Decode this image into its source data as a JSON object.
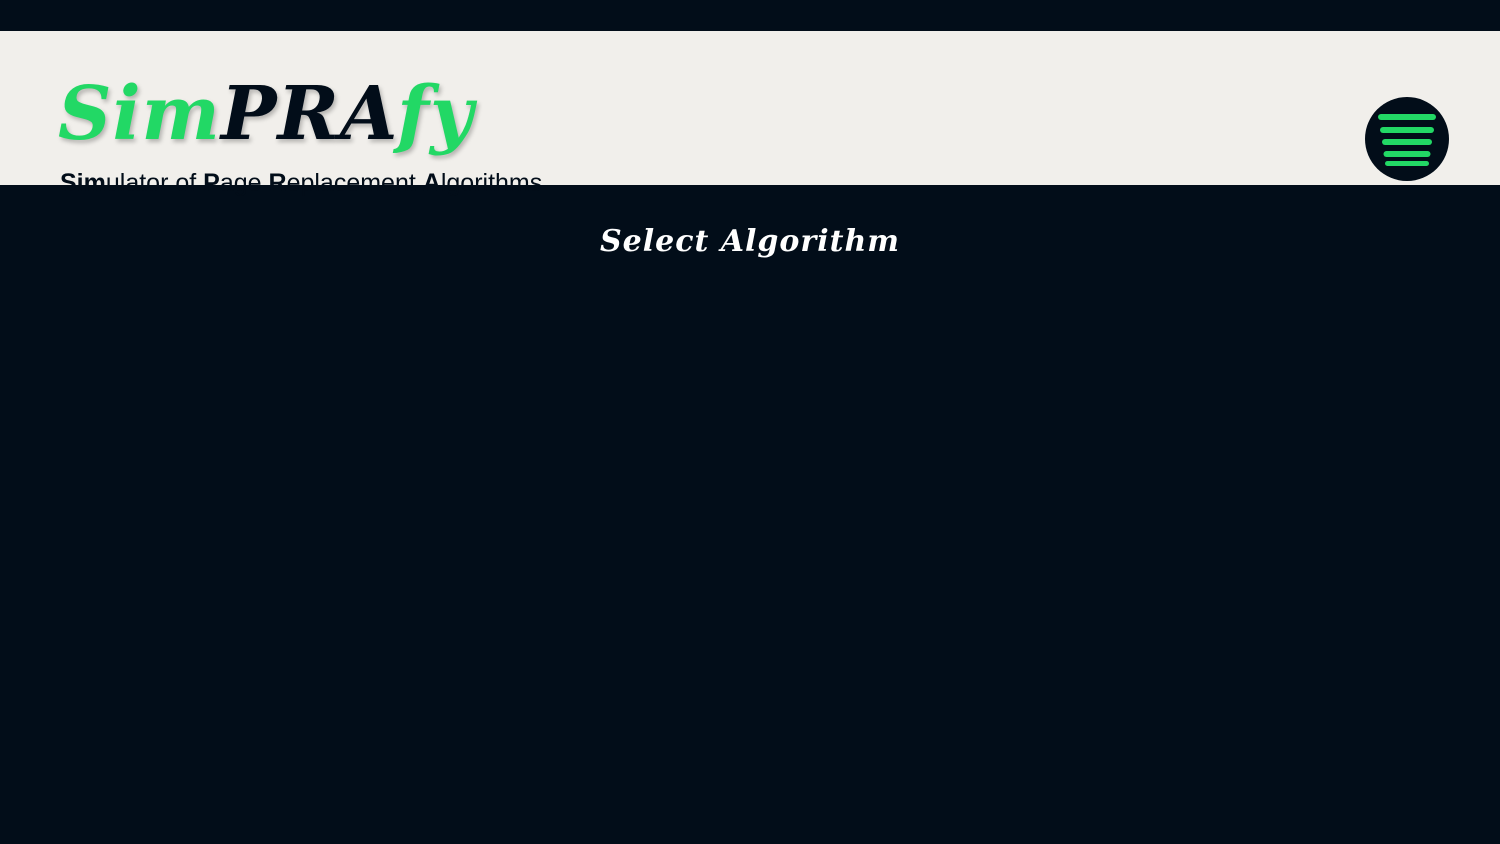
{
  "logo": {
    "part1": "Sim",
    "part2": "PRA",
    "part3": "fy"
  },
  "subtitle": {
    "s1": "Sim",
    "s2": "ulator of ",
    "s3": "P",
    "s4": "age ",
    "s5": "R",
    "s6": "eplacement ",
    "s7": "A",
    "s8": "lgorithms"
  },
  "menu": {
    "icon": "hamburger-menu-icon"
  },
  "main": {
    "heading": "Select Algorithm"
  },
  "colors": {
    "accent": "#22d865",
    "dark": "#020d19",
    "header_bg": "#f1efeb"
  }
}
